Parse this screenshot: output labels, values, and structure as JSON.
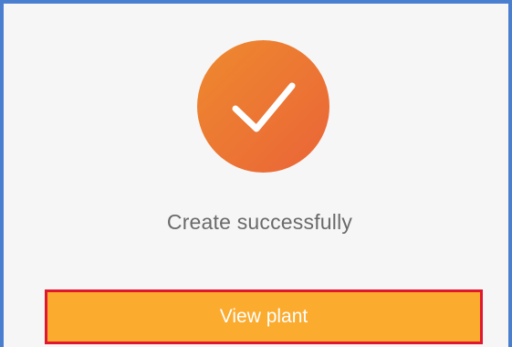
{
  "dialog": {
    "message": "Create successfully",
    "view_button_label": "View plant"
  },
  "icons": {
    "success": "checkmark-icon"
  },
  "colors": {
    "icon_gradient_start": "#ee8a2e",
    "icon_gradient_end": "#ea6438",
    "button_background": "#fbab2e",
    "button_highlight_border": "#e0182e",
    "frame_border": "#4a7fd0",
    "message_text": "#6a6a6a"
  }
}
